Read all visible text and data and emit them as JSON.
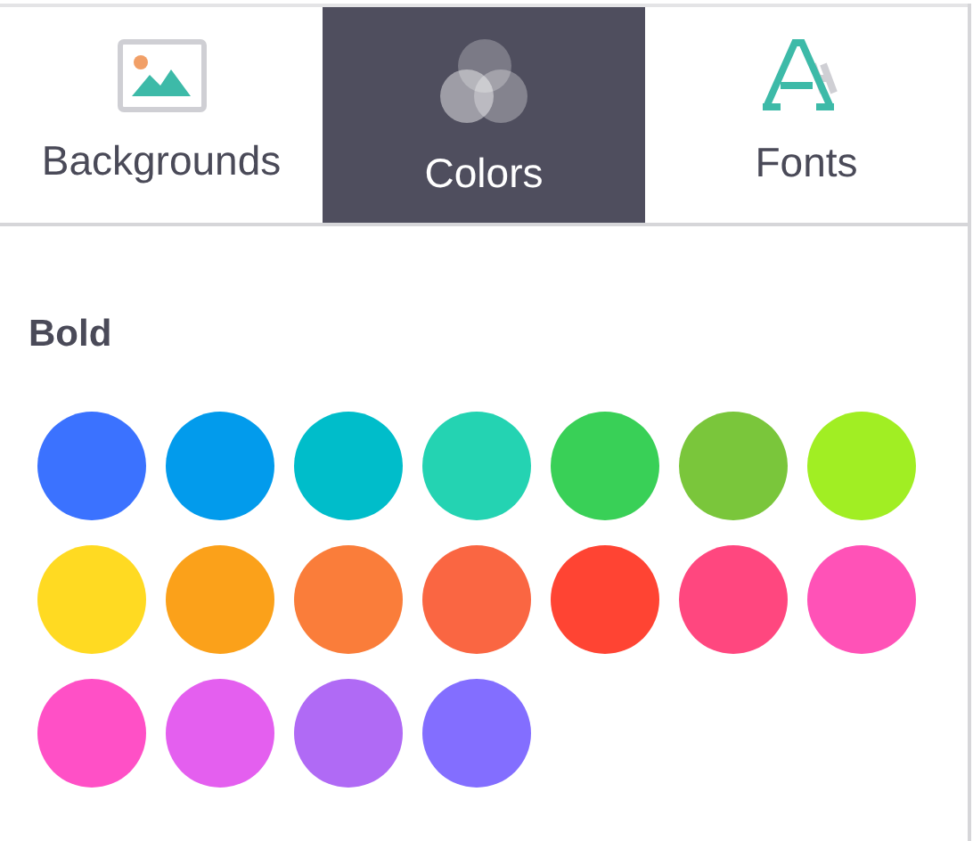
{
  "tabs": [
    {
      "label": "Backgrounds",
      "kind": "image",
      "selected": false
    },
    {
      "label": "Colors",
      "kind": "circles",
      "selected": true
    },
    {
      "label": "Fonts",
      "kind": "letters",
      "selected": false
    }
  ],
  "palette": {
    "title": "Bold",
    "swatches": [
      {
        "color": "#3b72ff"
      },
      {
        "color": "#029bec"
      },
      {
        "color": "#00bdca"
      },
      {
        "color": "#24d3b2"
      },
      {
        "color": "#39d057"
      },
      {
        "color": "#7ac63b"
      },
      {
        "color": "#a1ee23"
      },
      {
        "color": "#ffda22"
      },
      {
        "color": "#fba11a"
      },
      {
        "color": "#fa7d3a"
      },
      {
        "color": "#fa6642"
      },
      {
        "color": "#ff4433"
      },
      {
        "color": "#ff477f"
      },
      {
        "color": "#ff52b7"
      },
      {
        "color": "#ff50c6"
      },
      {
        "color": "#e45fef"
      },
      {
        "color": "#b06af5"
      },
      {
        "color": "#836eff"
      }
    ]
  }
}
